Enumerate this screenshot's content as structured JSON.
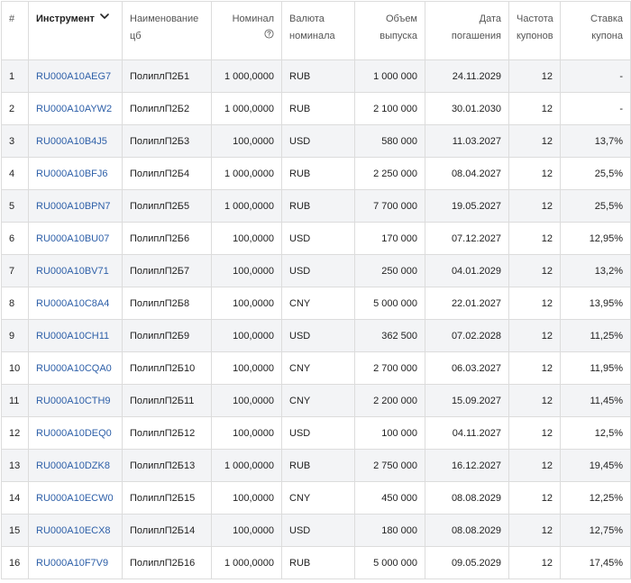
{
  "columns": {
    "num": "#",
    "isin": "Инструмент",
    "name_1": "Наименование",
    "name_2": "цб",
    "nominal": "Номинал",
    "currency_1": "Валюта",
    "currency_2": "номинала",
    "volume_1": "Объем",
    "volume_2": "выпуска",
    "maturity_1": "Дата",
    "maturity_2": "погашения",
    "freq_1": "Частота",
    "freq_2": "купонов",
    "rate_1": "Ставка",
    "rate_2": "купона"
  },
  "icons": {
    "sort": "chevron-down-icon",
    "help": "question-circle-icon"
  },
  "colors": {
    "link": "#2d5fa8",
    "row_stripe": "#f3f4f6",
    "border": "#dcdcdc"
  },
  "rows": [
    {
      "num": "1",
      "isin": "RU000A10AEG7",
      "name": "ПолиплП2Б1",
      "nominal": "1 000,0000",
      "currency": "RUB",
      "volume": "1 000 000",
      "maturity": "24.11.2029",
      "freq": "12",
      "rate": "-"
    },
    {
      "num": "2",
      "isin": "RU000A10AYW2",
      "name": "ПолиплП2Б2",
      "nominal": "1 000,0000",
      "currency": "RUB",
      "volume": "2 100 000",
      "maturity": "30.01.2030",
      "freq": "12",
      "rate": "-"
    },
    {
      "num": "3",
      "isin": "RU000A10B4J5",
      "name": "ПолиплП2Б3",
      "nominal": "100,0000",
      "currency": "USD",
      "volume": "580 000",
      "maturity": "11.03.2027",
      "freq": "12",
      "rate": "13,7%"
    },
    {
      "num": "4",
      "isin": "RU000A10BFJ6",
      "name": "ПолиплП2Б4",
      "nominal": "1 000,0000",
      "currency": "RUB",
      "volume": "2 250 000",
      "maturity": "08.04.2027",
      "freq": "12",
      "rate": "25,5%"
    },
    {
      "num": "5",
      "isin": "RU000A10BPN7",
      "name": "ПолиплП2Б5",
      "nominal": "1 000,0000",
      "currency": "RUB",
      "volume": "7 700 000",
      "maturity": "19.05.2027",
      "freq": "12",
      "rate": "25,5%"
    },
    {
      "num": "6",
      "isin": "RU000A10BU07",
      "name": "ПолиплП2Б6",
      "nominal": "100,0000",
      "currency": "USD",
      "volume": "170 000",
      "maturity": "07.12.2027",
      "freq": "12",
      "rate": "12,95%"
    },
    {
      "num": "7",
      "isin": "RU000A10BV71",
      "name": "ПолиплП2Б7",
      "nominal": "100,0000",
      "currency": "USD",
      "volume": "250 000",
      "maturity": "04.01.2029",
      "freq": "12",
      "rate": "13,2%"
    },
    {
      "num": "8",
      "isin": "RU000A10C8A4",
      "name": "ПолиплП2Б8",
      "nominal": "100,0000",
      "currency": "CNY",
      "volume": "5 000 000",
      "maturity": "22.01.2027",
      "freq": "12",
      "rate": "13,95%"
    },
    {
      "num": "9",
      "isin": "RU000A10CH11",
      "name": "ПолиплП2Б9",
      "nominal": "100,0000",
      "currency": "USD",
      "volume": "362 500",
      "maturity": "07.02.2028",
      "freq": "12",
      "rate": "11,25%"
    },
    {
      "num": "10",
      "isin": "RU000A10CQA0",
      "name": "ПолиплП2Б10",
      "nominal": "100,0000",
      "currency": "CNY",
      "volume": "2 700 000",
      "maturity": "06.03.2027",
      "freq": "12",
      "rate": "11,95%"
    },
    {
      "num": "11",
      "isin": "RU000A10CTH9",
      "name": "ПолиплП2Б11",
      "nominal": "100,0000",
      "currency": "CNY",
      "volume": "2 200 000",
      "maturity": "15.09.2027",
      "freq": "12",
      "rate": "11,45%"
    },
    {
      "num": "12",
      "isin": "RU000A10DEQ0",
      "name": "ПолиплП2Б12",
      "nominal": "100,0000",
      "currency": "USD",
      "volume": "100 000",
      "maturity": "04.11.2027",
      "freq": "12",
      "rate": "12,5%"
    },
    {
      "num": "13",
      "isin": "RU000A10DZK8",
      "name": "ПолиплП2Б13",
      "nominal": "1 000,0000",
      "currency": "RUB",
      "volume": "2 750 000",
      "maturity": "16.12.2027",
      "freq": "12",
      "rate": "19,45%"
    },
    {
      "num": "14",
      "isin": "RU000A10ECW0",
      "name": "ПолиплП2Б15",
      "nominal": "100,0000",
      "currency": "CNY",
      "volume": "450 000",
      "maturity": "08.08.2029",
      "freq": "12",
      "rate": "12,25%"
    },
    {
      "num": "15",
      "isin": "RU000A10ECX8",
      "name": "ПолиплП2Б14",
      "nominal": "100,0000",
      "currency": "USD",
      "volume": "180 000",
      "maturity": "08.08.2029",
      "freq": "12",
      "rate": "12,75%"
    },
    {
      "num": "16",
      "isin": "RU000A10F7V9",
      "name": "ПолиплП2Б16",
      "nominal": "1 000,0000",
      "currency": "RUB",
      "volume": "5 000 000",
      "maturity": "09.05.2029",
      "freq": "12",
      "rate": "17,45%"
    }
  ]
}
